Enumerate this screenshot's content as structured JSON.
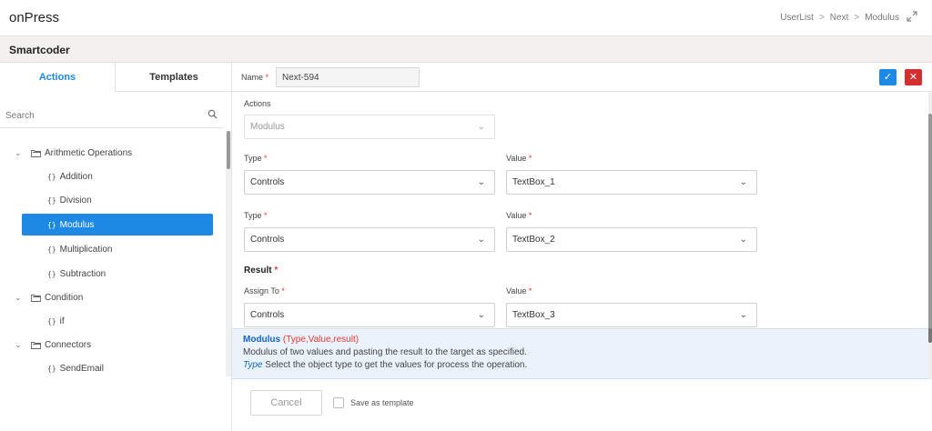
{
  "app": {
    "title": "onPress"
  },
  "breadcrumb": [
    "UserList",
    "Next",
    "Modulus"
  ],
  "breadcrumb_sep": ">",
  "subheader": {
    "title": "Smartcoder"
  },
  "tabs": [
    {
      "label": "Actions"
    },
    {
      "label": "Templates"
    }
  ],
  "search": {
    "placeholder": "Search"
  },
  "tree": {
    "groups": [
      {
        "label": "Arithmetic Operations",
        "items": [
          "Addition",
          "Division",
          "Modulus",
          "Multiplication",
          "Subtraction"
        ]
      },
      {
        "label": "Condition",
        "items": [
          "if"
        ]
      },
      {
        "label": "Connectors",
        "items": [
          "SendEmail"
        ]
      }
    ],
    "active_item": "Modulus",
    "leaf_glyph": "{}"
  },
  "namebar": {
    "label": "Name",
    "required_mark": "*",
    "value": "Next-594"
  },
  "form": {
    "actions_label": "Actions",
    "actions_value": "Modulus",
    "type_label": "Type",
    "value_label": "Value",
    "row1": {
      "type": "Controls",
      "value": "TextBox_1"
    },
    "row2": {
      "type": "Controls",
      "value": "TextBox_2"
    },
    "result_label": "Result",
    "assign_label": "Assign To",
    "row3": {
      "type": "Controls",
      "value": "TextBox_3"
    }
  },
  "help": {
    "name": "Modulus",
    "signature": "(Type,Value,result)",
    "description": "Modulus of two values and pasting the result to the target as specified.",
    "param_name": "Type",
    "param_desc": "Select the object type to get the values for process the operation."
  },
  "footer": {
    "cancel_label": "Cancel",
    "save_template_label": "Save as template"
  },
  "colors": {
    "accent": "#1e88e5",
    "danger": "#d32f2f"
  }
}
